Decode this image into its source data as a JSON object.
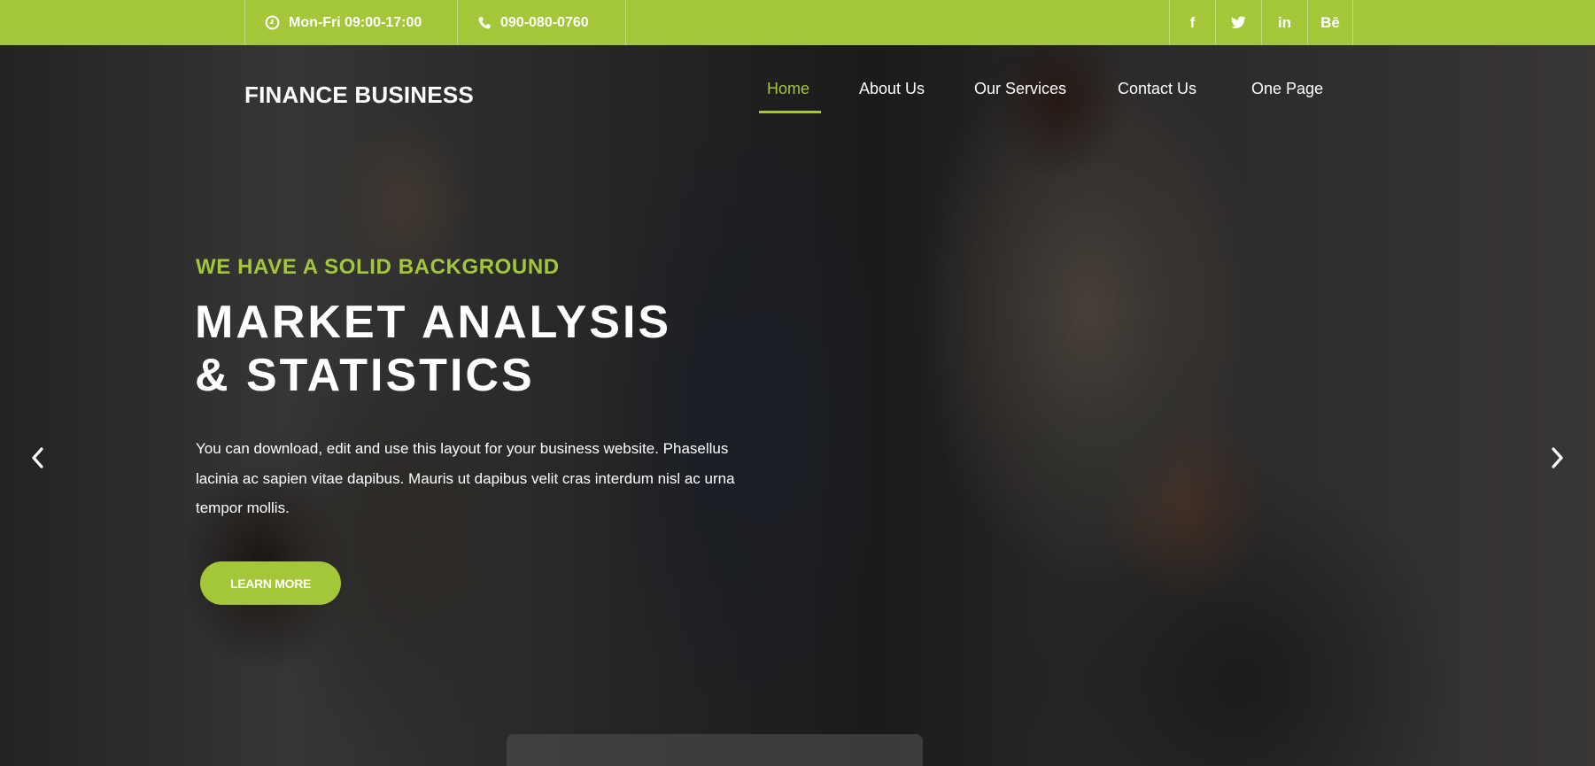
{
  "topbar": {
    "hours": "Mon-Fri 09:00-17:00",
    "phone": "090-080-0760",
    "social": [
      {
        "icon": "facebook-icon",
        "glyph": "f"
      },
      {
        "icon": "twitter-icon",
        "glyph": ""
      },
      {
        "icon": "linkedin-icon",
        "glyph": "in"
      },
      {
        "icon": "behance-icon",
        "glyph": "Bē"
      }
    ]
  },
  "header": {
    "logo": "FINANCE BUSINESS",
    "nav": [
      "Home",
      "About Us",
      "Our Services",
      "Contact Us",
      "One Page"
    ],
    "active_index": 0
  },
  "hero": {
    "eyebrow": "WE HAVE A SOLID BACKGROUND",
    "title_line1": "MARKET ANALYSIS",
    "title_line2": "& STATISTICS",
    "description": "You can download, edit and use this layout for your business website. Phasellus lacinia ac sapien vitae dapibus. Mauris ut dapibus velit cras interdum nisl ac urna tempor mollis.",
    "button": "LEARN MORE"
  },
  "colors": {
    "accent": "#a4c639",
    "text": "#ffffff"
  }
}
